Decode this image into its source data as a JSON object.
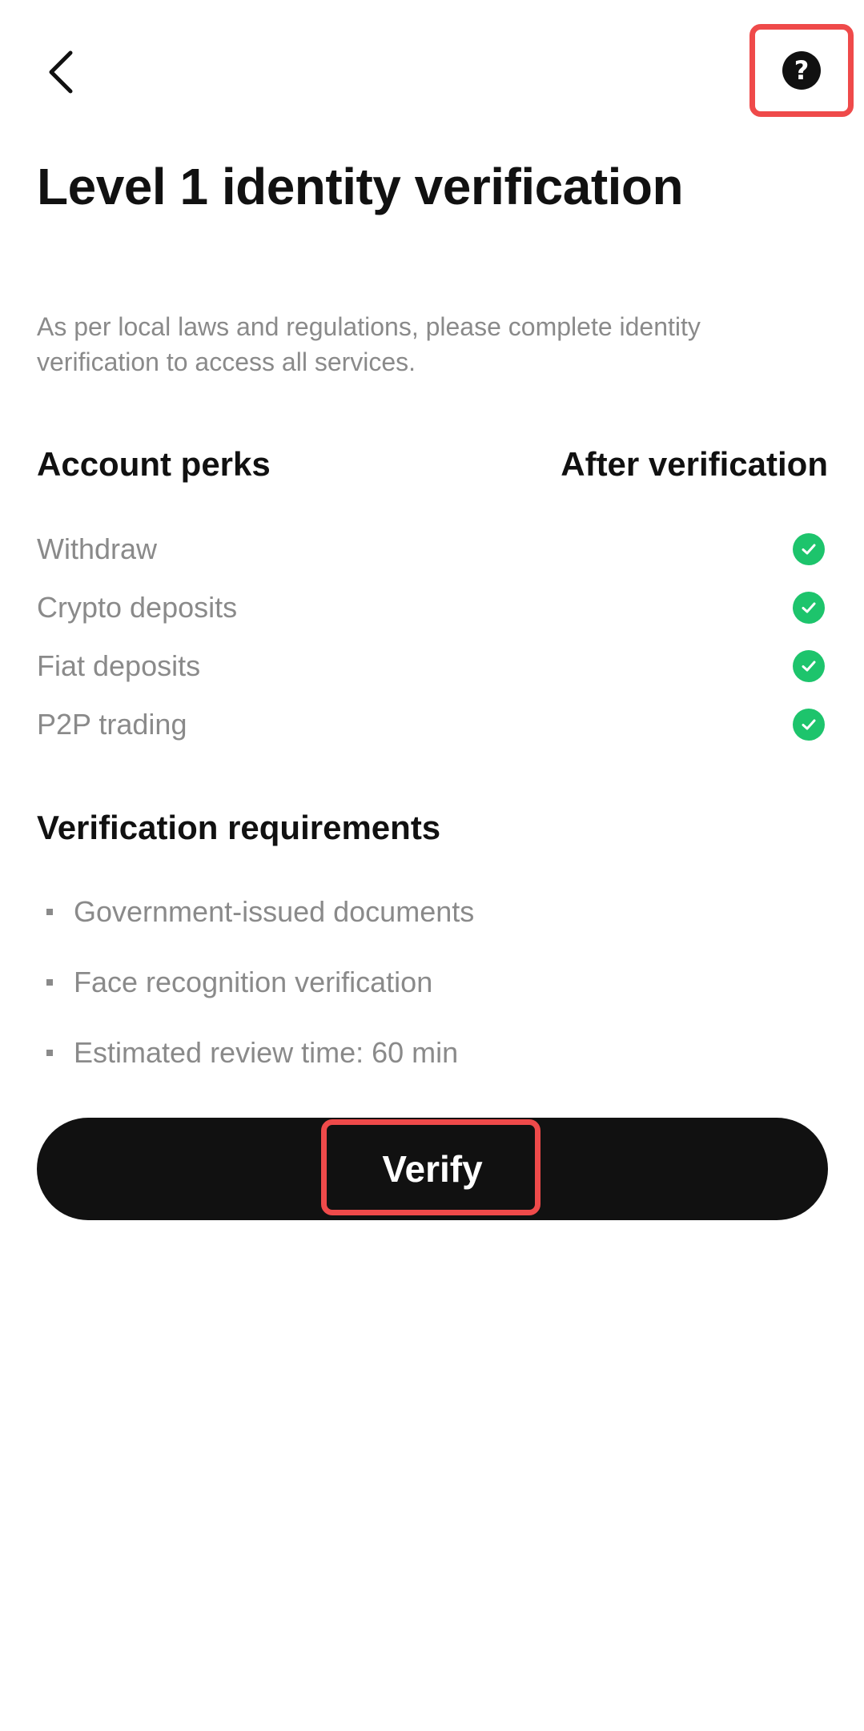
{
  "header": {
    "back_icon": "chevron-left-icon",
    "help_icon": "question-circle-icon",
    "help_symbol": "?"
  },
  "title": "Level 1 identity verification",
  "subtitle": "As per local laws and regulations, please complete identity verification to access all services.",
  "perks": {
    "col_left": "Account perks",
    "col_right": "After verification",
    "items": [
      {
        "label": "Withdraw",
        "status_icon": "check-circle-icon"
      },
      {
        "label": "Crypto deposits",
        "status_icon": "check-circle-icon"
      },
      {
        "label": "Fiat deposits",
        "status_icon": "check-circle-icon"
      },
      {
        "label": "P2P trading",
        "status_icon": "check-circle-icon"
      }
    ]
  },
  "requirements": {
    "title": "Verification requirements",
    "items": [
      "Government-issued documents",
      "Face recognition verification",
      "Estimated review time: 60 min"
    ]
  },
  "verify_button": {
    "label": "Verify"
  },
  "colors": {
    "accent_green": "#1dc46c",
    "button_bg": "#111111",
    "highlight_red": "#ef4a4a",
    "muted_text": "#8a8a8a"
  }
}
